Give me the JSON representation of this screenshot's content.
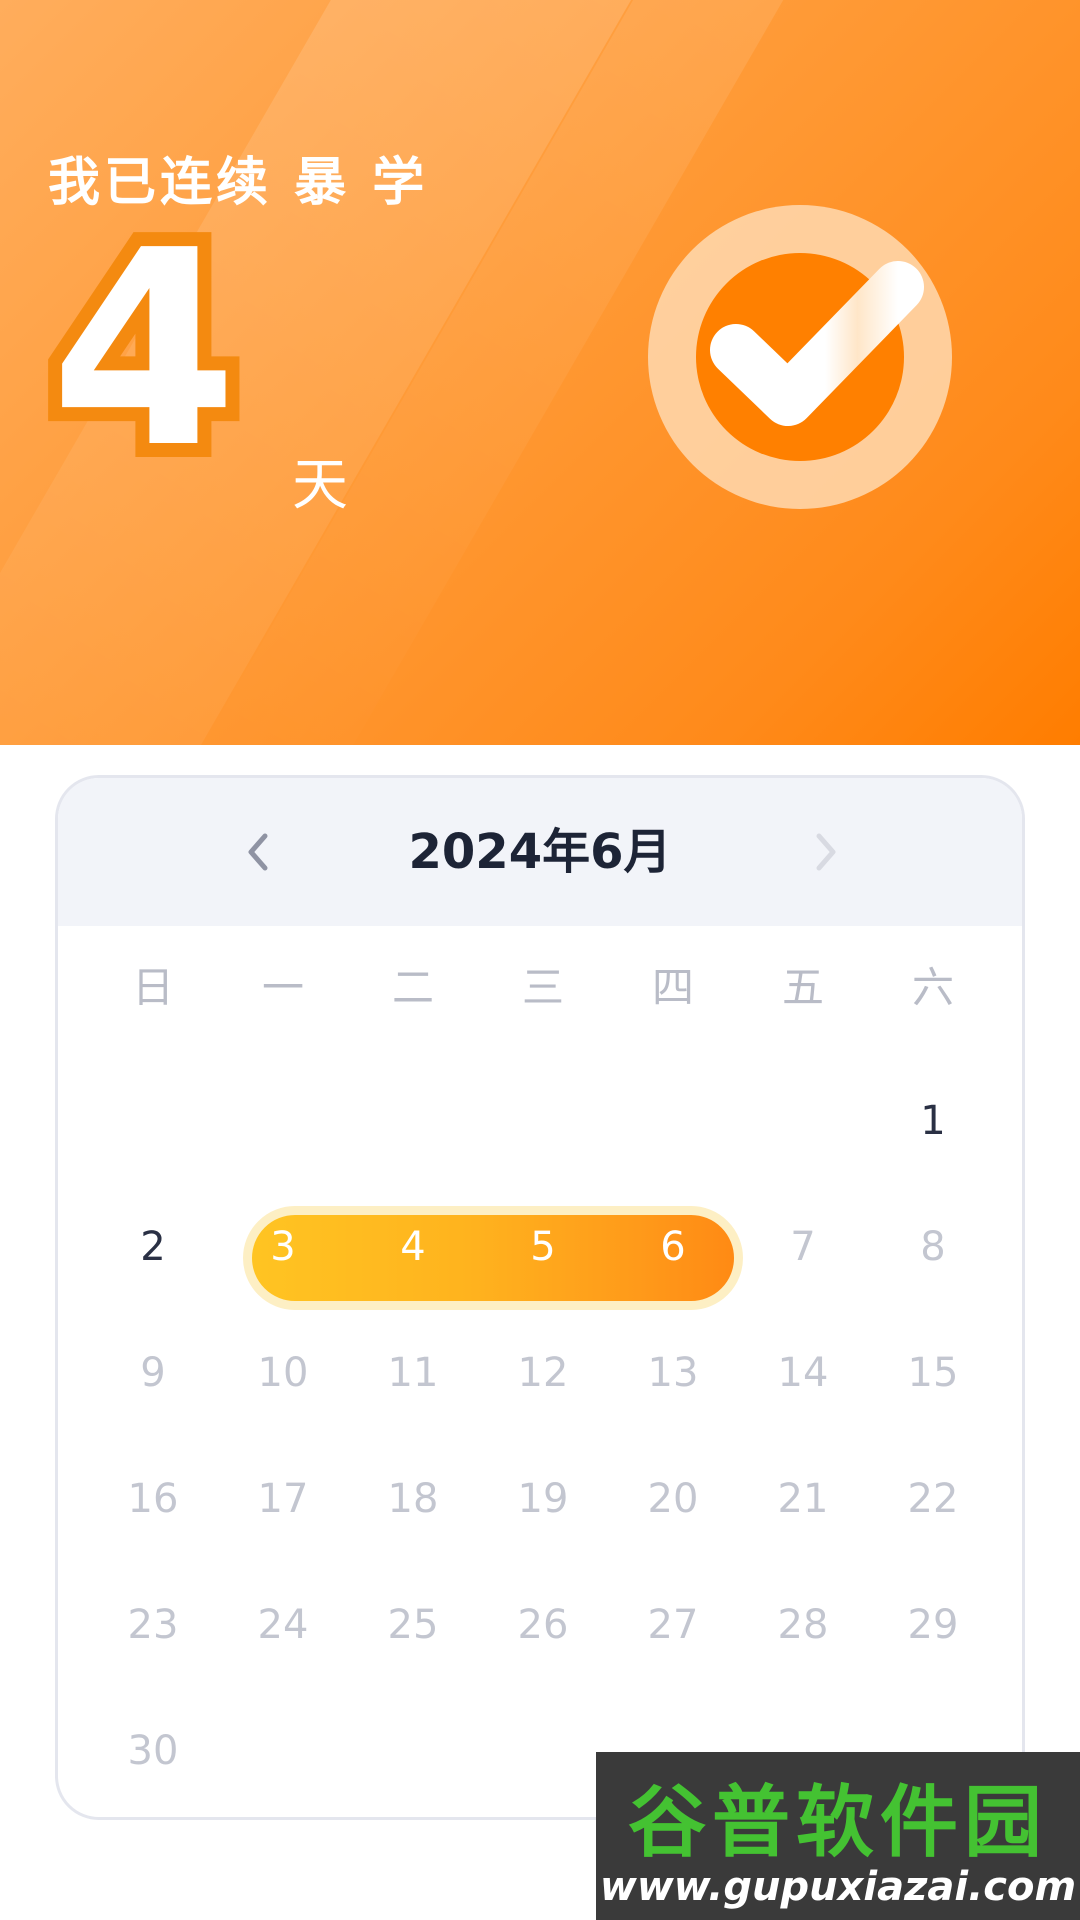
{
  "hero": {
    "title": "我已连续 暴 学",
    "days": "4",
    "unit": "天",
    "colors": {
      "background_start": "#ffad5c",
      "background_end": "#ff7d00",
      "digit_outline": "#f48a10"
    }
  },
  "calendar": {
    "month_title": "2024年6月",
    "prev_icon": "chevron-left-icon",
    "next_icon": "chevron-right-icon",
    "weekdays": [
      "日",
      "一",
      "二",
      "三",
      "四",
      "五",
      "六"
    ],
    "weeks": [
      [
        "",
        "",
        "",
        "",
        "",
        "",
        "1"
      ],
      [
        "2",
        "3",
        "4",
        "5",
        "6",
        "7",
        "8"
      ],
      [
        "9",
        "10",
        "11",
        "12",
        "13",
        "14",
        "15"
      ],
      [
        "16",
        "17",
        "18",
        "19",
        "20",
        "21",
        "22"
      ],
      [
        "23",
        "24",
        "25",
        "26",
        "27",
        "28",
        "29"
      ],
      [
        "30",
        "",
        "",
        "",
        "",
        "",
        ""
      ]
    ],
    "streak_days": [
      "3",
      "4",
      "5",
      "6"
    ],
    "colors": {
      "streak_start": "#ffc422",
      "streak_end": "#ff8a14",
      "past_day": "#2a3044",
      "future_day": "#c3c6d0"
    }
  },
  "watermark": {
    "title": "谷普软件园",
    "url": "www.gupuxiazai.com"
  }
}
